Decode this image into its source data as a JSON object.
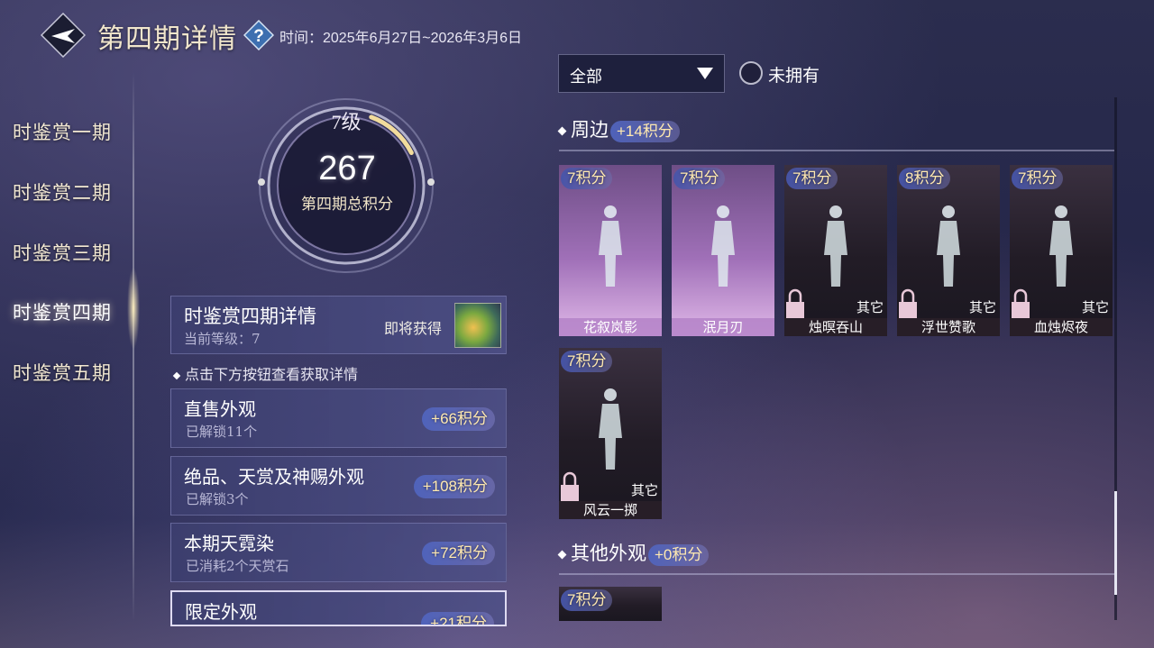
{
  "header": {
    "title": "第四期详情",
    "period": "时间：2025年6月27日~2026年3月6日"
  },
  "nav": {
    "items": [
      {
        "label": "时鉴赏一期"
      },
      {
        "label": "时鉴赏二期"
      },
      {
        "label": "时鉴赏三期"
      },
      {
        "label": "时鉴赏四期",
        "active": true
      },
      {
        "label": "时鉴赏五期"
      }
    ]
  },
  "score": {
    "level": "7级",
    "total": "267",
    "label": "第四期总积分",
    "level_progress": 0.12
  },
  "detail": {
    "title": "时鉴赏四期详情",
    "current_level": "当前等级：7",
    "upcoming": "即将获得"
  },
  "hint": "点击下方按钮查看获取详情",
  "sources": [
    {
      "title": "直售外观",
      "sub": "已解锁11个",
      "points": "+66积分"
    },
    {
      "title": "绝品、天赏及神赐外观",
      "sub": "已解锁3个",
      "points": "+108积分"
    },
    {
      "title": "本期天霓染",
      "sub": "已消耗2个天赏石",
      "points": "+72积分"
    },
    {
      "title": "限定外观",
      "sub": "",
      "points": "+21积分"
    }
  ],
  "filter": {
    "selected": "全部",
    "unowned_label": "未拥有",
    "unowned_checked": false
  },
  "sections": [
    {
      "title": "周边",
      "points": "+14积分",
      "items": [
        {
          "points": "7积分",
          "name": "花叙岚影",
          "owned": true
        },
        {
          "points": "7积分",
          "name": "泯月刃",
          "owned": true
        },
        {
          "points": "7积分",
          "name": "烛暝吞山",
          "owned": false,
          "tag": "其它"
        },
        {
          "points": "8积分",
          "name": "浮世赞歌",
          "owned": false,
          "tag": "其它"
        },
        {
          "points": "7积分",
          "name": "血烛烬夜",
          "owned": false,
          "tag": "其它"
        },
        {
          "points": "7积分",
          "name": "风云一掷",
          "owned": false,
          "tag": "其它"
        }
      ]
    },
    {
      "title": "其他外观",
      "points": "+0积分",
      "items": [
        {
          "points": "7积分"
        }
      ]
    }
  ],
  "icons": {
    "back": "back-arrow-icon",
    "help": "question-icon",
    "dropdown": "triangle-down-icon",
    "lock": "lock-icon"
  },
  "colors": {
    "badge_text": "#ffe9b0",
    "owned_card": "#a070b8",
    "locked_card": "#221c26"
  }
}
